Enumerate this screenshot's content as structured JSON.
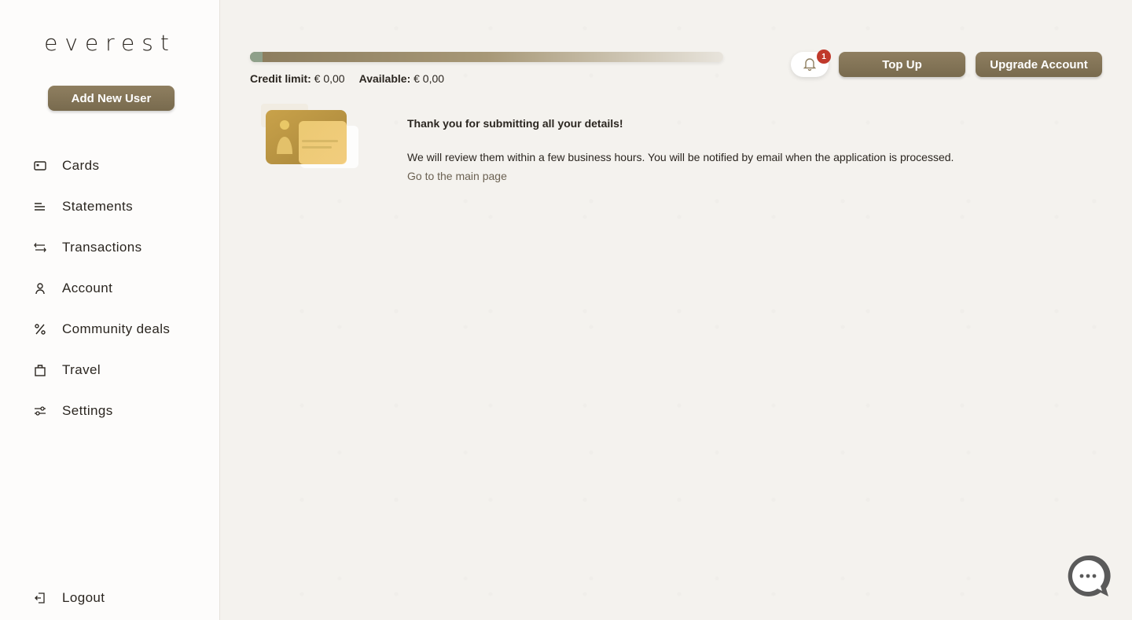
{
  "brand": {
    "logo_text": "everest"
  },
  "sidebar": {
    "add_user_label": "Add New User",
    "items": [
      {
        "label": "Cards",
        "icon": "card-icon"
      },
      {
        "label": "Statements",
        "icon": "lines-icon"
      },
      {
        "label": "Transactions",
        "icon": "arrows-icon"
      },
      {
        "label": "Account",
        "icon": "user-icon"
      },
      {
        "label": "Community deals",
        "icon": "percent-icon"
      },
      {
        "label": "Travel",
        "icon": "bag-icon"
      },
      {
        "label": "Settings",
        "icon": "sliders-icon"
      }
    ],
    "logout_label": "Logout"
  },
  "header": {
    "credit_limit_label": "Credit limit:",
    "credit_limit_value": "€ 0,00",
    "available_label": "Available:",
    "available_value": "€ 0,00",
    "notification_count": "1",
    "top_up_label": "Top Up",
    "upgrade_label": "Upgrade Account"
  },
  "message": {
    "title": "Thank you for submitting all your details!",
    "body": "We will review them within a few business hours. You will be notified by email when the application is processed.",
    "link": "Go to the main page"
  },
  "colors": {
    "accent": "#867758",
    "badge": "#c0392b",
    "sidebar_bg": "#fdfcfb",
    "page_bg": "#f4f2ee"
  }
}
